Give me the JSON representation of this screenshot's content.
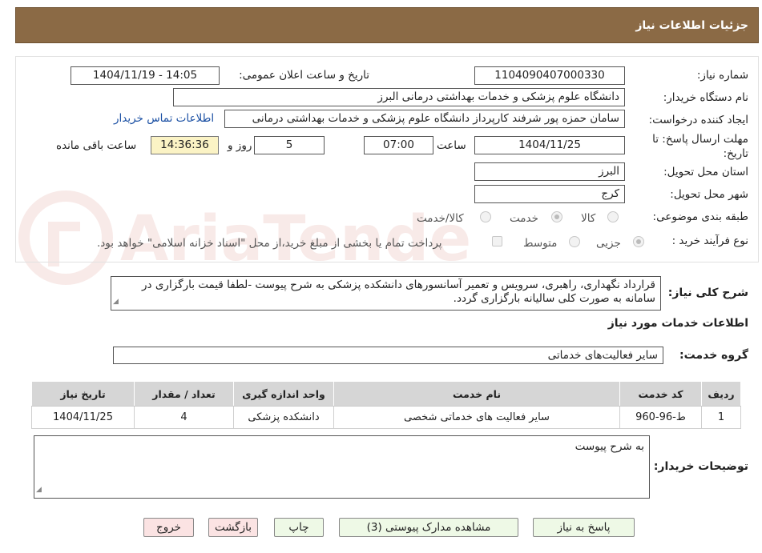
{
  "header": {
    "title": "جزئیات اطلاعات نیاز"
  },
  "form": {
    "need_number_label": "شماره نیاز:",
    "need_number": "1104090407000330",
    "announce_label": "تاریخ و ساعت اعلان عمومی:",
    "announce_value": "1404/11/19 - 14:05",
    "buyer_org_label": "نام دستگاه خریدار:",
    "buyer_org": "دانشگاه علوم پزشکی و خدمات بهداشتی  درمانی البرز",
    "requester_label": "ایجاد کننده درخواست:",
    "requester": "سامان حمزه پور شرفند کارپرداز دانشگاه علوم پزشکی و خدمات بهداشتی  درمانی",
    "contact_link": "اطلاعات تماس خریدار",
    "deadline_label_1": "مهلت ارسال پاسخ: تا",
    "deadline_label_2": "تاریخ:",
    "deadline_date": "1404/11/25",
    "time_label": "ساعت",
    "deadline_time": "07:00",
    "days_value": "5",
    "days_label": "روز و",
    "remaining_time": "14:36:36",
    "remaining_label": "ساعت باقی مانده",
    "province_label": "استان محل تحویل:",
    "province": "البرز",
    "city_label": "شهر محل تحویل:",
    "city": "کرج",
    "category_label": "طبقه بندی موضوعی:",
    "category_options": [
      "کالا",
      "خدمت",
      "کالا/خدمت"
    ],
    "process_label": "نوع فرآیند خرید :",
    "process_options": [
      "جزیی",
      "متوسط"
    ],
    "payment_note": "پرداخت تمام یا بخشی از مبلغ خرید،از محل \"اسناد خزانه اسلامی\" خواهد بود."
  },
  "description": {
    "label": "شرح کلی نیاز:",
    "text": "قرارداد نگهداری، راهبری، سرویس و تعمیر آسانسورهای دانشکده پزشکی به شرح پیوست -لطفا قیمت بارگزاری در سامانه به صورت کلی سالیانه بارگزاری گردد."
  },
  "services": {
    "title": "اطلاعات خدمات مورد نیاز",
    "group_label": "گروه خدمت:",
    "group_value": "سایر فعالیت‌های خدماتی",
    "columns": [
      "ردیف",
      "کد خدمت",
      "نام خدمت",
      "واحد اندازه گیری",
      "تعداد / مقدار",
      "تاریخ نیاز"
    ],
    "rows": [
      [
        "1",
        "ط-96-960",
        "سایر فعالیت های خدماتی شخصی",
        "دانشکده پزشکی",
        "4",
        "1404/11/25"
      ]
    ]
  },
  "buyer_notes": {
    "label": "توضیحات خریدار:",
    "text": "به شرح پیوست"
  },
  "buttons": {
    "reply": "پاسخ به نیاز",
    "attachments": "مشاهده مدارک پیوستی (3)",
    "print": "چاپ",
    "back": "بازگشت",
    "exit": "خروج"
  },
  "watermark": {
    "text": "AriaTender.neT"
  },
  "colors": {
    "header_bg": "#8b6a45",
    "remaining_bg": "#fbf3c5",
    "button_green": "#eef9e6",
    "button_red": "#fbe3e3",
    "table_header": "#d6d6d6",
    "link": "#1a4fa3"
  }
}
